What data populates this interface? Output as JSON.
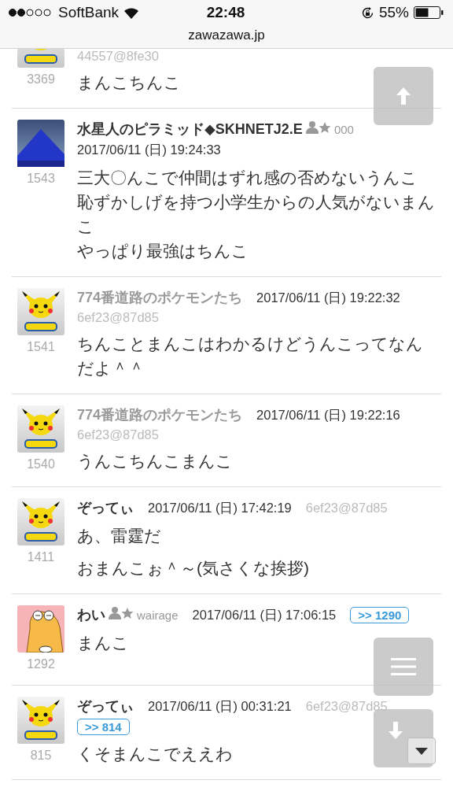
{
  "status_bar": {
    "carrier": "SoftBank",
    "time": "22:48",
    "battery": "55%"
  },
  "address_bar": {
    "url": "zawazawa.jp"
  },
  "posts": [
    {
      "avatar": {
        "kind": "character"
      },
      "number": "3369",
      "id": "44557@8fe30",
      "body": [
        [
          "まんこちんこ"
        ]
      ]
    },
    {
      "avatar": {
        "kind": "photo"
      },
      "number": "1543",
      "name": "水星人のピラミッド◆SKHNETJ2.E",
      "greyed": false,
      "member_badge": true,
      "handle": "000",
      "date": "2017/06/11 (日) 19:24:33",
      "body": [
        [
          "三大〇んこで仲間はずれ感の否めないうんこ",
          "恥ずかしげを持つ小学生からの人気がないまんこ",
          "やっぱり最強はちんこ"
        ]
      ]
    },
    {
      "avatar": {
        "kind": "character"
      },
      "number": "1541",
      "name": "774番道路のポケモンたち",
      "greyed": true,
      "member_badge": false,
      "date": "2017/06/11 (日) 19:22:32",
      "id": "6ef23@87d85",
      "body": [
        [
          "ちんことまんこはわかるけどうんこってなんだよ＾＾"
        ]
      ]
    },
    {
      "avatar": {
        "kind": "character"
      },
      "number": "1540",
      "name": "774番道路のポケモンたち",
      "greyed": true,
      "member_badge": false,
      "date": "2017/06/11 (日) 19:22:16",
      "id": "6ef23@87d85",
      "body": [
        [
          "うんこちんこまんこ"
        ]
      ]
    },
    {
      "avatar": {
        "kind": "character"
      },
      "number": "1411",
      "name": "ぞってぃ",
      "greyed": false,
      "member_badge": false,
      "date": "2017/06/11 (日) 17:42:19",
      "id": "6ef23@87d85",
      "body": [
        [
          "あ、雷霆だ"
        ],
        [
          "おまんこぉ＾～(気さくな挨拶)"
        ]
      ]
    },
    {
      "avatar": {
        "kind": "cartoon"
      },
      "number": "1292",
      "name": "わい",
      "greyed": false,
      "member_badge": true,
      "handle": "wairage",
      "date": "2017/06/11 (日) 17:06:15",
      "reply": ">> 1290",
      "body": [
        [
          "まんこ"
        ]
      ]
    },
    {
      "avatar": {
        "kind": "character"
      },
      "number": "815",
      "name": "ぞってぃ",
      "greyed": false,
      "member_badge": false,
      "date": "2017/06/11 (日) 00:31:21",
      "id": "6ef23@87d85",
      "reply": ">> 814",
      "body": [
        [
          "くそまんこでええわ"
        ]
      ]
    }
  ],
  "floating_buttons": [
    {
      "kind": "up"
    },
    {
      "kind": "menu"
    },
    {
      "kind": "down"
    },
    {
      "kind": "dropdown"
    }
  ]
}
